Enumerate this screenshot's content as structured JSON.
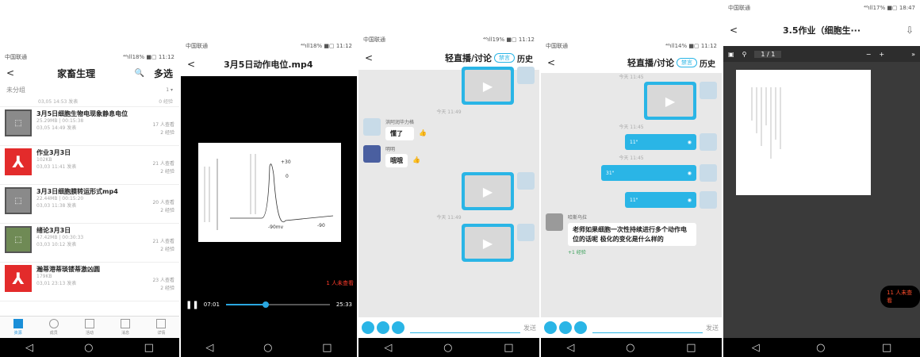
{
  "phone1": {
    "status_carrier": "中国联通",
    "status_right": "⁴⁶ıll18% ■▢ 11:12",
    "back": "<",
    "title": "家畜生理",
    "search": "🔍",
    "multi": "多选",
    "group_label": "未分组",
    "group_right": "1 ▾",
    "top_meta": "03,05 14:53 发表",
    "top_count": "0 经验",
    "items": [
      {
        "title": "3月5日细胞生物电现象静息电位",
        "meta1": "25.29MB | 00:15:38",
        "meta2": "03,05 14:49 发表",
        "r1": "17 人查看",
        "r2": "2 经验"
      },
      {
        "title": "作业3月3日",
        "meta1": "102KB",
        "meta2": "03,03 11:41 发表",
        "r1": "21 人查看",
        "r2": "2 经验"
      },
      {
        "title": "3月3日细胞膜转运形式mp4",
        "meta1": "22.44MB | 00:15:20",
        "meta2": "03,03 11:38 发表",
        "r1": "20 人查看",
        "r2": "2 经验"
      },
      {
        "title": "绪论3月3日",
        "meta1": "47.42MB | 00:30:33",
        "meta2": "03,03 10:12 发表",
        "r1": "21 人查看",
        "r2": "2 经验"
      },
      {
        "title": "瀚蒂港蒂琰镂蒂激凶圆",
        "meta1": "179KB",
        "meta2": "03,01 23:13 发表",
        "r1": "23 人查看",
        "r2": "2 经验"
      }
    ],
    "tabs": [
      "资源",
      "成员",
      "活动",
      "消息",
      "详情"
    ]
  },
  "phone2": {
    "status_carrier": "中国联通",
    "status_right": "⁴⁶ıll18% ■▢ 11:12",
    "title": "3月5日动作电位.mp4",
    "graph_label1": "+30",
    "graph_label2": "0",
    "graph_label3": "-90mv",
    "graph_label4": "-90",
    "viewers": "1 人未查看",
    "time_cur": "07:01",
    "time_total": "25:33",
    "progress": 0.38
  },
  "phone3": {
    "status_carrier": "中国联通",
    "status_right": "⁴⁶ıll19% ■▢ 11:12",
    "title": "轻直播/讨论",
    "mute": "禁言",
    "history": "历史",
    "time1": "今天 11:49",
    "sender1": "洪阿润毕力格",
    "msg1": "懂了",
    "sender2": "明明",
    "msg2": "哦哦",
    "time2": "今天 11:49",
    "send": "发送"
  },
  "phone4": {
    "status_carrier": "中国联通",
    "status_right": "⁴⁶ıll14% ■▢ 11:12",
    "title": "轻直播/讨论",
    "mute": "禁言",
    "history": "历史",
    "time1": "今天 11:45",
    "time2": "今天 11:45",
    "voice1": "11\"",
    "time3": "今天 11:45",
    "voice2": "31\"",
    "voice3": "11\"",
    "sender": "哈斯乌拉",
    "question": "老师如果细胞一次性持续进行多个动作电位的话呢 极化的变化是什么样的",
    "exp": "+1 经验",
    "send": "发送"
  },
  "phone5": {
    "status_carrier": "中国联通",
    "status_right": "⁴⁶ıll17% ■▢ 18:47",
    "title": "3.5作业（细胞生···",
    "page": "1 / 1",
    "minus": "−",
    "plus": "+",
    "more": "»",
    "unread": "11 人未查看"
  },
  "sysnav": [
    "◁",
    "○",
    "□"
  ]
}
